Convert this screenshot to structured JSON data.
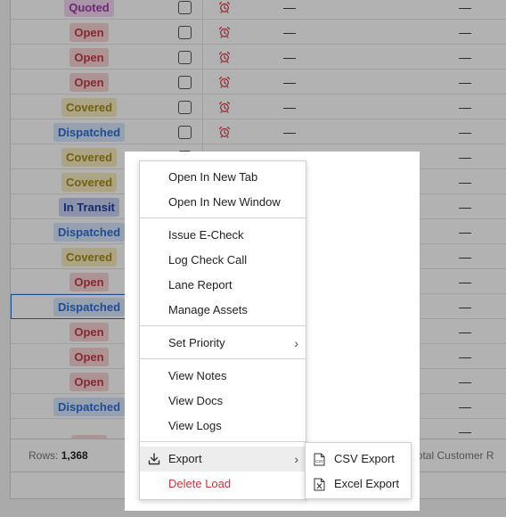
{
  "rows": [
    {
      "status": "Quoted",
      "fg": "#9b3aa3",
      "bg": "#f1d6f0"
    },
    {
      "status": "Open",
      "fg": "#c23a48",
      "bg": "#f6d3d5"
    },
    {
      "status": "Open",
      "fg": "#c23a48",
      "bg": "#f6d3d5"
    },
    {
      "status": "Open",
      "fg": "#c23a48",
      "bg": "#f6d3d5"
    },
    {
      "status": "Covered",
      "fg": "#a58a12",
      "bg": "#f5ebc2"
    },
    {
      "status": "Dispatched",
      "fg": "#2f6fd1",
      "bg": "#d7e5fb"
    },
    {
      "status": "Covered",
      "fg": "#a58a12",
      "bg": "#f5ebc2"
    },
    {
      "status": "Covered",
      "fg": "#a58a12",
      "bg": "#f5ebc2"
    },
    {
      "status": "In Transit",
      "fg": "#203d9b",
      "bg": "#c9d3f3"
    },
    {
      "status": "Dispatched",
      "fg": "#2f6fd1",
      "bg": "#d7e5fb"
    },
    {
      "status": "Covered",
      "fg": "#a58a12",
      "bg": "#f5ebc2"
    },
    {
      "status": "Open",
      "fg": "#c23a48",
      "bg": "#f6d3d5"
    },
    {
      "status": "Dispatched",
      "fg": "#2f6fd1",
      "bg": "#d7e5fb",
      "selected": true
    },
    {
      "status": "Open",
      "fg": "#c23a48",
      "bg": "#f6d3d5"
    },
    {
      "status": "Open",
      "fg": "#c23a48",
      "bg": "#f6d3d5"
    },
    {
      "status": "Open",
      "fg": "#c23a48",
      "bg": "#f6d3d5"
    },
    {
      "status": "Dispatched",
      "fg": "#2f6fd1",
      "bg": "#d7e5fb"
    },
    {
      "status": "",
      "fg": "#c23a48",
      "bg": "#f6d3d5"
    }
  ],
  "dash": "—",
  "footer": {
    "rows_label": "Rows:",
    "rows_count": "1,368",
    "right_text": "2  Total Customer R"
  },
  "context_menu": {
    "items": {
      "open_new_tab": "Open In New Tab",
      "open_new_window": "Open In New Window",
      "issue_echeck": "Issue E-Check",
      "log_check_call": "Log Check Call",
      "lane_report": "Lane Report",
      "manage_assets": "Manage Assets",
      "set_priority": "Set Priority",
      "view_notes": "View Notes",
      "view_docs": "View Docs",
      "view_logs": "View Logs",
      "export": "Export",
      "delete_load": "Delete Load"
    },
    "chevron": "›"
  },
  "export_submenu": {
    "csv": "CSV Export",
    "excel": "Excel Export"
  },
  "colors": {
    "danger": "#d0333f",
    "alarm": "#d0333f",
    "selection": "#2f6fd1"
  }
}
